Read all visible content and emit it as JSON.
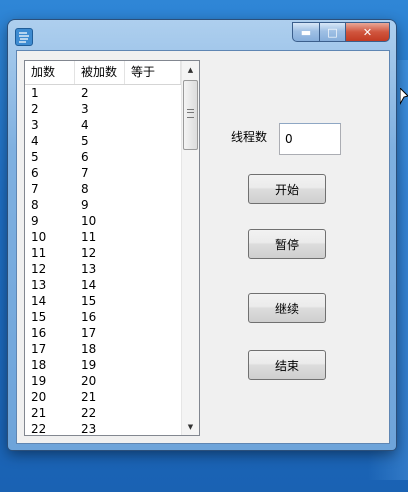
{
  "window": {
    "title": "",
    "caption_buttons": {
      "minimize": "▬",
      "maximize": "□",
      "close": "✕"
    }
  },
  "listview": {
    "columns": [
      "加数",
      "被加数",
      "等于"
    ],
    "rows": [
      [
        "1",
        "2",
        ""
      ],
      [
        "2",
        "3",
        ""
      ],
      [
        "3",
        "4",
        ""
      ],
      [
        "4",
        "5",
        ""
      ],
      [
        "5",
        "6",
        ""
      ],
      [
        "6",
        "7",
        ""
      ],
      [
        "7",
        "8",
        ""
      ],
      [
        "8",
        "9",
        ""
      ],
      [
        "9",
        "10",
        ""
      ],
      [
        "10",
        "11",
        ""
      ],
      [
        "11",
        "12",
        ""
      ],
      [
        "12",
        "13",
        ""
      ],
      [
        "13",
        "14",
        ""
      ],
      [
        "14",
        "15",
        ""
      ],
      [
        "15",
        "16",
        ""
      ],
      [
        "16",
        "17",
        ""
      ],
      [
        "17",
        "18",
        ""
      ],
      [
        "18",
        "19",
        ""
      ],
      [
        "19",
        "20",
        ""
      ],
      [
        "20",
        "21",
        ""
      ],
      [
        "21",
        "22",
        ""
      ],
      [
        "22",
        "23",
        ""
      ]
    ]
  },
  "threads": {
    "label": "线程数",
    "value": "0"
  },
  "buttons": {
    "start": "开始",
    "pause": "暂停",
    "resume": "继续",
    "end": "结束"
  },
  "colors": {
    "desktop": "#1f6fc4",
    "client_bg": "#f0f0f0",
    "close_button": "#c23a22"
  }
}
